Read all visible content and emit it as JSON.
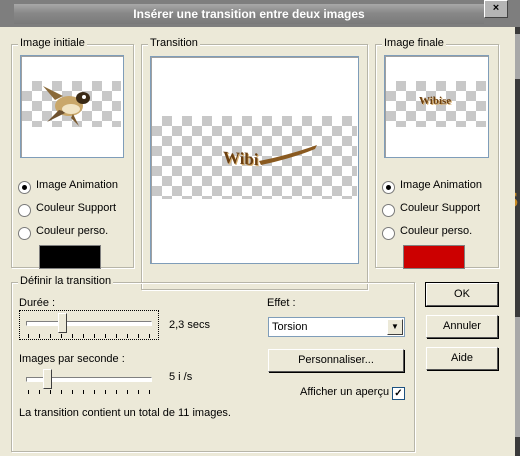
{
  "window": {
    "title": "Insérer une transition entre deux images",
    "close_label": "×"
  },
  "initial_image": {
    "group_label": "Image initiale",
    "radio_options": [
      {
        "label": "Image Animation",
        "selected": true
      },
      {
        "label": "Couleur Support",
        "selected": false
      },
      {
        "label": "Couleur perso.",
        "selected": false
      }
    ],
    "custom_color": "#000000"
  },
  "transition": {
    "group_label": "Transition",
    "preview_text": "Wibi"
  },
  "final_image": {
    "group_label": "Image finale",
    "preview_text": "Wibise",
    "radio_options": [
      {
        "label": "Image Animation",
        "selected": true
      },
      {
        "label": "Couleur Support",
        "selected": false
      },
      {
        "label": "Couleur perso.",
        "selected": false
      }
    ],
    "custom_color": "#cc0000"
  },
  "define": {
    "group_label": "Définir la transition",
    "duration": {
      "label": "Durée :",
      "value_text": "2,3 secs"
    },
    "fps": {
      "label": "Images par seconde :",
      "value_text": "5 i /s"
    },
    "summary": "La transition contient un total de 11 images.",
    "effect": {
      "label": "Effet :",
      "selected": "Torsion",
      "customize_label": "Personnaliser...",
      "preview_label": "Afficher un aperçu",
      "preview_checked": true,
      "check_glyph": "✓"
    }
  },
  "buttons": {
    "ok": "OK",
    "cancel": "Annuler",
    "help": "Aide"
  },
  "background": {
    "strip_glyph": "S"
  }
}
